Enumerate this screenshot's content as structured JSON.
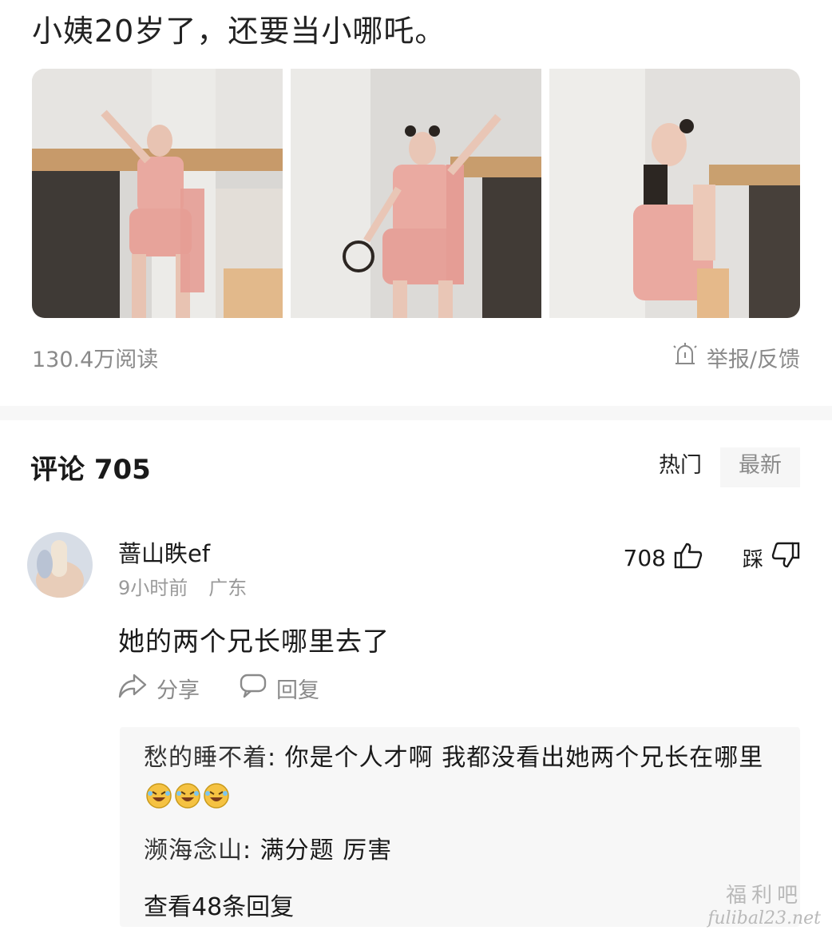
{
  "post": {
    "title": "小姨20岁了，还要当小哪吒。",
    "reads": "130.4万阅读",
    "report": "举报/反馈"
  },
  "comments_header": {
    "title": "评论 705",
    "sort_hot": "热门",
    "sort_new": "最新"
  },
  "comment": {
    "user": "蔷山眣ef",
    "time": "9小时前",
    "location": "广东",
    "likes": "708",
    "dislike_label": "踩",
    "text": "她的两个兄长哪里去了",
    "share_label": "分享",
    "reply_label": "回复"
  },
  "replies": [
    {
      "user": "愁的睡不着",
      "text": "你是个人才啊 我都没看出她两个兄长在哪里"
    },
    {
      "user": "濒海念山",
      "text": "满分题 厉害"
    }
  ],
  "view_more": "查看48条回复",
  "watermark": {
    "cn": "福利吧",
    "url": "fulibal23.net"
  },
  "icons": [
    "report-icon",
    "thumbs-up-icon",
    "thumbs-down-icon",
    "share-icon",
    "comment-icon",
    "laugh-emoji-icon"
  ]
}
